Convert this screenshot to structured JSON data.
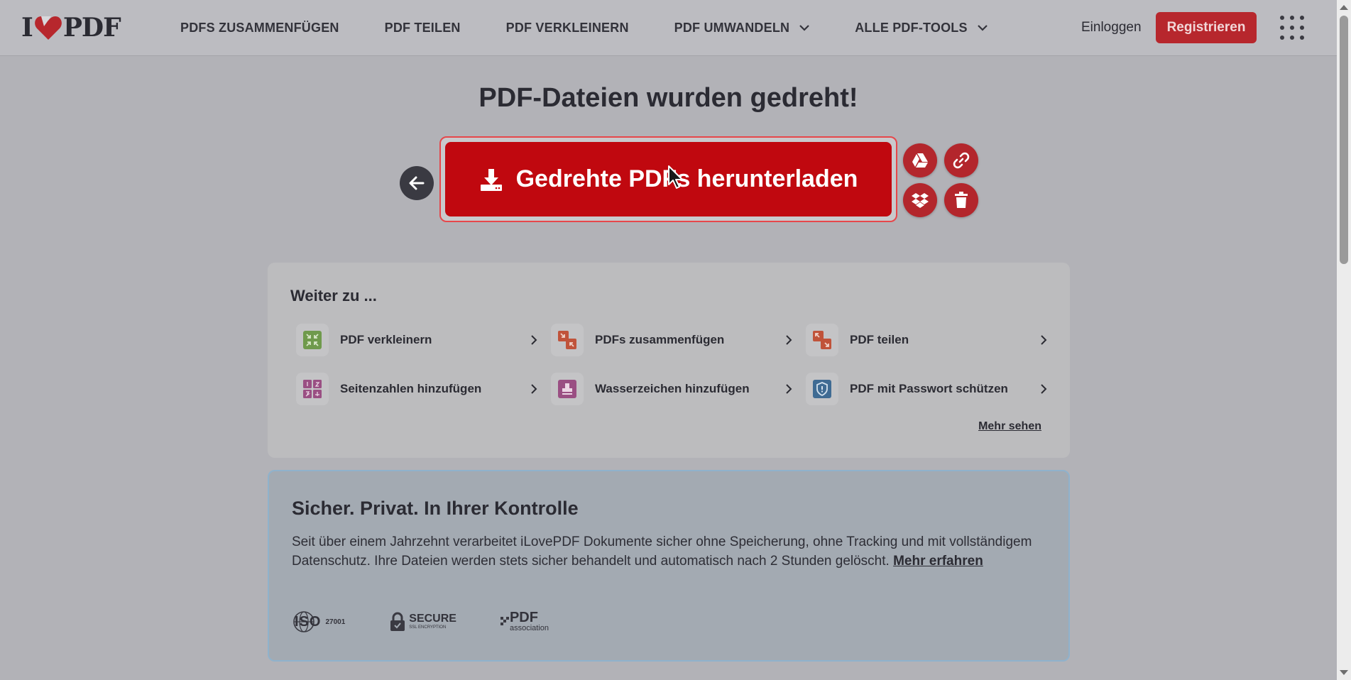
{
  "header": {
    "logo_left": "I",
    "logo_right": "PDF",
    "nav": [
      {
        "label": "PDFS ZUSAMMENFÜGEN",
        "dropdown": false
      },
      {
        "label": "PDF TEILEN",
        "dropdown": false
      },
      {
        "label": "PDF VERKLEINERN",
        "dropdown": false
      },
      {
        "label": "PDF UMWANDELN",
        "dropdown": true
      },
      {
        "label": "ALLE PDF-TOOLS",
        "dropdown": true
      }
    ],
    "login": "Einloggen",
    "register": "Registrieren"
  },
  "hero": {
    "title": "PDF-Dateien wurden gedreht!",
    "download_label": "Gedrehte PDFs herunterladen",
    "actions": [
      "google-drive-icon",
      "link-icon",
      "dropbox-icon",
      "trash-icon"
    ]
  },
  "continue": {
    "title": "Weiter zu ...",
    "tools": [
      {
        "label": "PDF verkleinern",
        "icon": "compress-icon",
        "color": "#6f9a4c"
      },
      {
        "label": "PDFs zusammenfügen",
        "icon": "merge-icon",
        "color": "#c0533a"
      },
      {
        "label": "PDF teilen",
        "icon": "split-icon",
        "color": "#c0533a"
      },
      {
        "label": "Seitenzahlen hinzufügen",
        "icon": "page-numbers-icon",
        "color": "#9a4f83"
      },
      {
        "label": "Wasserzeichen hinzufügen",
        "icon": "stamp-icon",
        "color": "#9a4f83"
      },
      {
        "label": "PDF mit Passwort schützen",
        "icon": "shield-icon",
        "color": "#3f6b93"
      }
    ],
    "more": "Mehr sehen"
  },
  "security": {
    "title": "Sicher. Privat. In Ihrer Kontrolle",
    "text": "Seit über einem Jahrzehnt verarbeitet iLovePDF Dokumente sicher ohne Speicherung, ohne Tracking und mit vollständigem Datenschutz. Ihre Dateien werden stets sicher behandelt und automatisch nach 2 Stunden gelöscht.",
    "link": "Mehr erfahren",
    "badges": {
      "iso": "ISO",
      "iso_num": "27001",
      "secure": "SECURE",
      "secure_sub": "SSL ENCRYPTION",
      "pdf": "PDF",
      "pdf_sub": "association"
    }
  },
  "colors": {
    "brand_red": "#c0080f",
    "register_red": "#b7272d",
    "action_red": "#b3262c"
  }
}
